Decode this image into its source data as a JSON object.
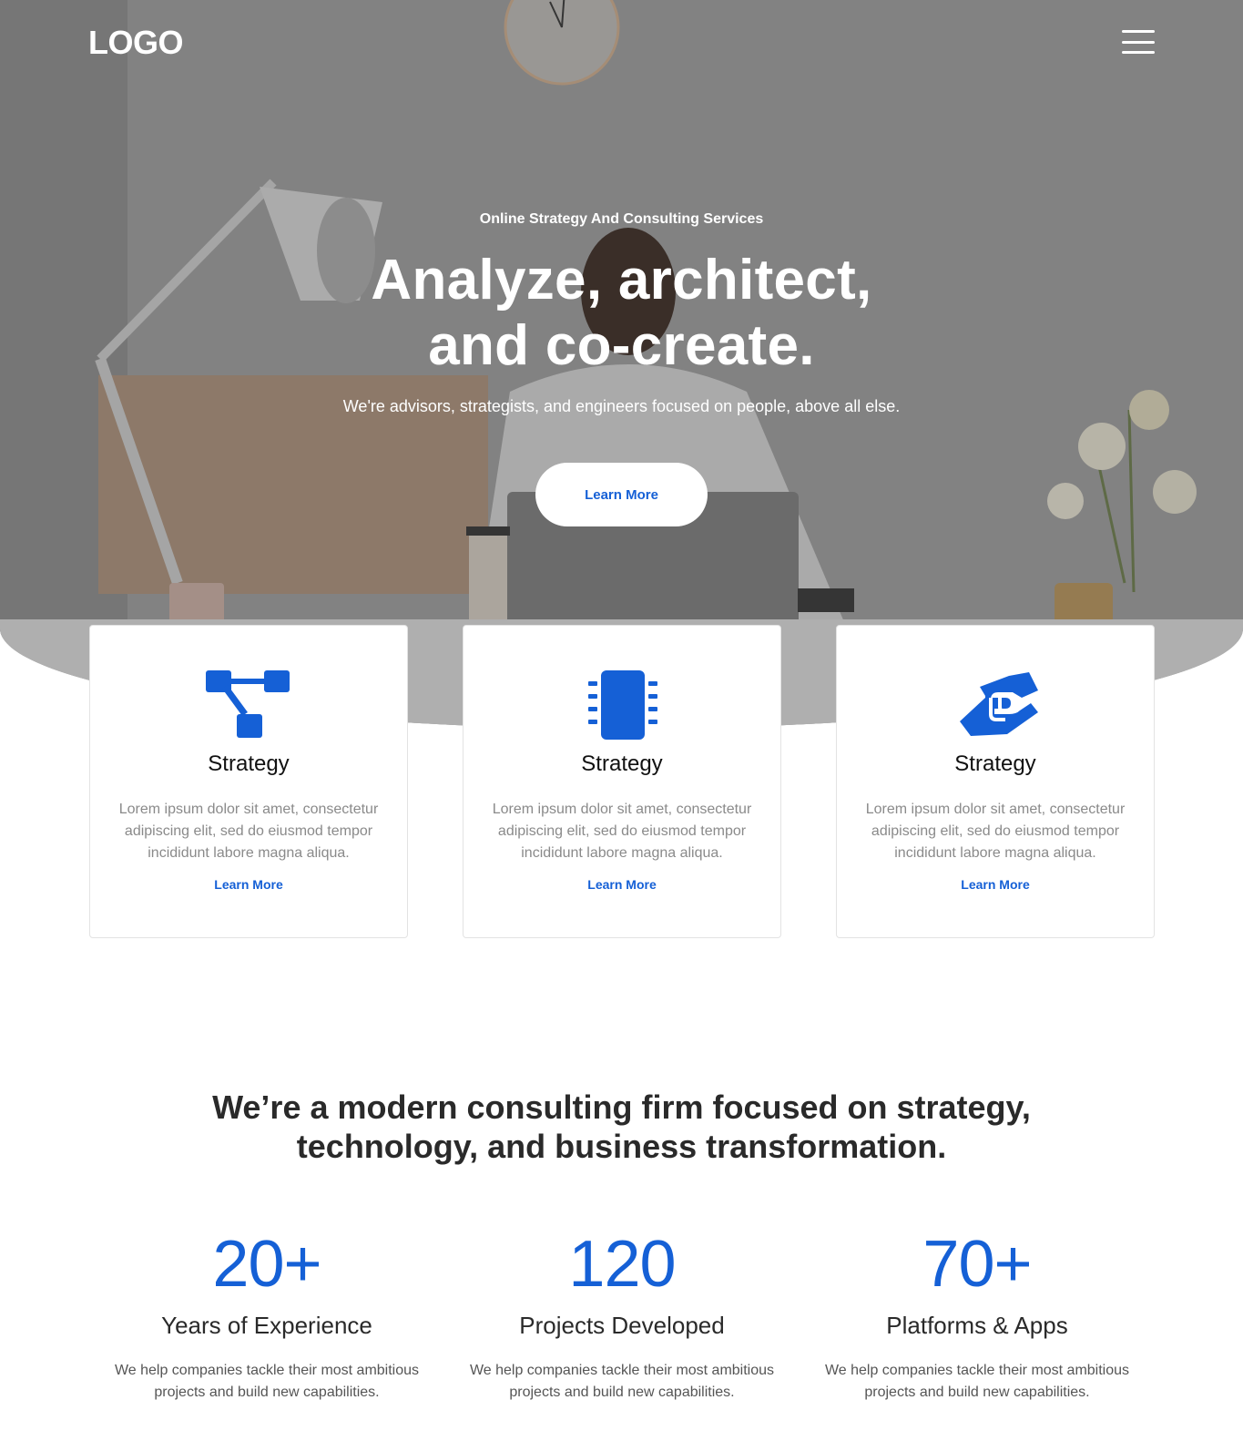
{
  "header": {
    "logo": "LOGO",
    "menu_icon": "hamburger-menu-icon"
  },
  "hero": {
    "kicker": "Online Strategy And Consulting Services",
    "title_line1": "Analyze, architect,",
    "title_line2": "and co-create.",
    "subtitle": "We're advisors, strategists, and engineers focused on people, above all else.",
    "cta_label": "Learn More"
  },
  "cards": [
    {
      "icon": "flowchart-icon",
      "title": "Strategy",
      "description": "Lorem ipsum dolor sit amet, consectetur adipiscing elit, sed do eiusmod tempor incididunt labore magna aliqua.",
      "link": "Learn More"
    },
    {
      "icon": "chip-icon",
      "title": "Strategy",
      "description": "Lorem ipsum dolor sit amet, consectetur adipiscing elit, sed do eiusmod tempor incididunt labore magna aliqua.",
      "link": "Learn More"
    },
    {
      "icon": "handshake-icon",
      "title": "Strategy",
      "description": "Lorem ipsum dolor sit amet, consectetur adipiscing elit, sed do eiusmod tempor incididunt labore magna aliqua.",
      "link": "Learn More"
    }
  ],
  "about": {
    "line1": "We’re a modern consulting firm focused on strategy,",
    "line2": "technology, and business transformation."
  },
  "stats": [
    {
      "number": "20+",
      "label": "Years of Experience",
      "description": "We help companies tackle their most ambitious projects and build new capabilities."
    },
    {
      "number": "120",
      "label": "Projects Developed",
      "description": "We help companies tackle their most ambitious projects and build new capabilities."
    },
    {
      "number": "70+",
      "label": "Platforms & Apps",
      "description": "We help companies tackle their most ambitious projects and build new capabilities."
    }
  ],
  "colors": {
    "accent": "#1560d6",
    "text_dark": "#2a2a2a",
    "text_muted": "#8a8a8a",
    "card_border": "#e3e3e3"
  }
}
